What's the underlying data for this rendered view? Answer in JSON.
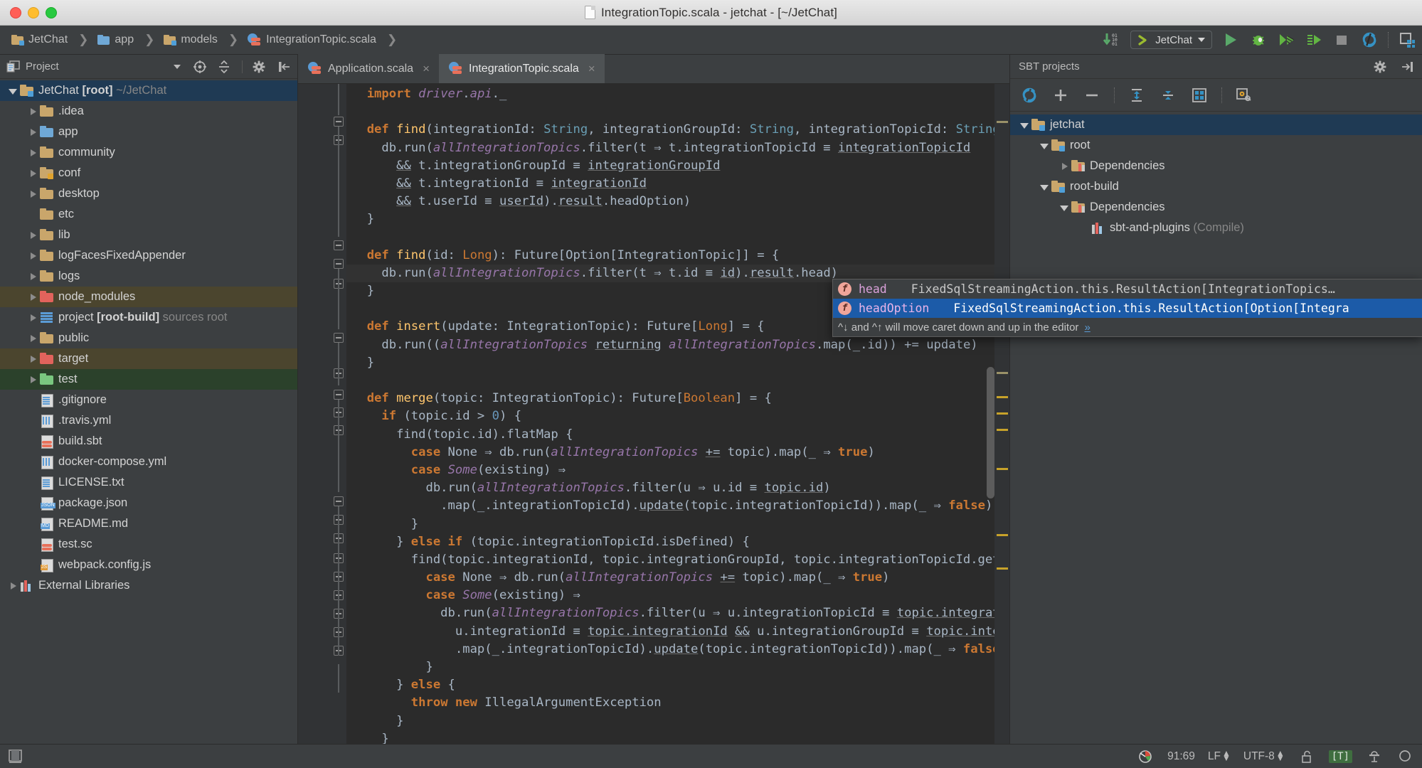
{
  "window": {
    "title": "IntegrationTopic.scala - jetchat - [~/JetChat]",
    "doc_icon": "document-icon",
    "traffic_lights": [
      "close",
      "minimize",
      "maximize"
    ]
  },
  "navbar": {
    "breadcrumb": [
      {
        "label": "JetChat",
        "icon": "module-folder-icon"
      },
      {
        "label": "app",
        "icon": "source-folder-icon"
      },
      {
        "label": "models",
        "icon": "package-folder-icon"
      },
      {
        "label": "IntegrationTopic.scala",
        "icon": "scala-file-icon"
      }
    ],
    "toolbar": {
      "update_label": "01 10 01",
      "run_config": "JetChat",
      "buttons": [
        "run",
        "debug",
        "coverage",
        "profile",
        "stop",
        "sync",
        "project-structure"
      ]
    }
  },
  "project_panel": {
    "title": "Project",
    "toolbar_icons": [
      "locate-icon",
      "collapse-all-icon",
      "settings-icon",
      "hide-icon"
    ],
    "tree": [
      {
        "label": "JetChat",
        "bold": "[root]",
        "dim": "~/JetChat",
        "depth": 0,
        "arrow": "open",
        "icon": "module-folder",
        "state": "selected"
      },
      {
        "label": ".idea",
        "depth": 1,
        "arrow": "closed",
        "icon": "folder"
      },
      {
        "label": "app",
        "depth": 1,
        "arrow": "closed",
        "icon": "folder-blue"
      },
      {
        "label": "community",
        "depth": 1,
        "arrow": "closed",
        "icon": "folder"
      },
      {
        "label": "conf",
        "depth": 1,
        "arrow": "closed",
        "icon": "folder-resource"
      },
      {
        "label": "desktop",
        "depth": 1,
        "arrow": "closed",
        "icon": "folder"
      },
      {
        "label": "etc",
        "depth": 1,
        "arrow": "none",
        "icon": "folder"
      },
      {
        "label": "lib",
        "depth": 1,
        "arrow": "closed",
        "icon": "folder"
      },
      {
        "label": "logFacesFixedAppender",
        "depth": 1,
        "arrow": "closed",
        "icon": "folder"
      },
      {
        "label": "logs",
        "depth": 1,
        "arrow": "closed",
        "icon": "folder"
      },
      {
        "label": "node_modules",
        "depth": 1,
        "arrow": "closed",
        "icon": "folder-red",
        "state": "excluded"
      },
      {
        "label": "project",
        "bold": "[root-build]",
        "dim": "sources root",
        "depth": 1,
        "arrow": "closed",
        "icon": "sources-stack"
      },
      {
        "label": "public",
        "depth": 1,
        "arrow": "closed",
        "icon": "folder"
      },
      {
        "label": "target",
        "depth": 1,
        "arrow": "closed",
        "icon": "folder-red",
        "state": "excluded"
      },
      {
        "label": "test",
        "depth": 1,
        "arrow": "closed",
        "icon": "folder-green",
        "state": "test-source"
      },
      {
        "label": ".gitignore",
        "depth": 1,
        "arrow": "none",
        "icon": "text-file"
      },
      {
        "label": ".travis.yml",
        "depth": 1,
        "arrow": "none",
        "icon": "yaml-file"
      },
      {
        "label": "build.sbt",
        "depth": 1,
        "arrow": "none",
        "icon": "sbt-file"
      },
      {
        "label": "docker-compose.yml",
        "depth": 1,
        "arrow": "none",
        "icon": "yaml-file"
      },
      {
        "label": "LICENSE.txt",
        "depth": 1,
        "arrow": "none",
        "icon": "text-file"
      },
      {
        "label": "package.json",
        "depth": 1,
        "arrow": "none",
        "icon": "json-file"
      },
      {
        "label": "README.md",
        "depth": 1,
        "arrow": "none",
        "icon": "md-file"
      },
      {
        "label": "test.sc",
        "depth": 1,
        "arrow": "none",
        "icon": "sbt-file"
      },
      {
        "label": "webpack.config.js",
        "depth": 1,
        "arrow": "none",
        "icon": "js-file"
      },
      {
        "label": "External Libraries",
        "depth": 0,
        "arrow": "closed",
        "icon": "library"
      }
    ]
  },
  "editor": {
    "tabs": [
      {
        "label": "Application.scala",
        "active": false,
        "icon": "scala-file-icon",
        "close": "×"
      },
      {
        "label": "IntegrationTopic.scala",
        "active": true,
        "icon": "scala-file-icon",
        "close": "×"
      }
    ],
    "code_lines": [
      {
        "caret": false,
        "html": "  <span class='kw'>import</span> <span class='it'>driver</span>.<span class='it'>api</span>._"
      },
      {
        "caret": false,
        "html": ""
      },
      {
        "caret": false,
        "html": "  <span class='kw'>def</span> <span class='fn'>find</span>(integrationId: <span class='ty'>String</span>, integrationGroupId: <span class='ty'>String</span>, integrationTopicId: <span class='ty'>String</span>, u"
      },
      {
        "caret": false,
        "html": "    db.run(<span class='it'>allIntegrationTopics</span>.filter(t ⇒ t.integrationTopicId <span class='eqq'>≡</span> <span class='ul'>integrationTopicId</span>"
      },
      {
        "caret": false,
        "html": "      <span class='ul'>&amp;&amp;</span> t.integrationGroupId <span class='eqq'>≡</span> <span class='ul'>integrationGroupId</span>"
      },
      {
        "caret": false,
        "html": "      <span class='ul'>&amp;&amp;</span> t.integrationId <span class='eqq'>≡</span> <span class='ul'>integrationId</span>"
      },
      {
        "caret": false,
        "html": "      <span class='ul'>&amp;&amp;</span> t.userId <span class='eqq'>≡</span> <span class='ul'>userId</span>).<span class='ul'>result</span>.headOption)"
      },
      {
        "caret": false,
        "html": "  }"
      },
      {
        "caret": false,
        "html": ""
      },
      {
        "caret": false,
        "html": "  <span class='kw'>def</span> <span class='fn'>find</span>(id: <span class='tyo'>Long</span>): Future[Option[IntegrationTopic]] = {"
      },
      {
        "caret": true,
        "html": "    db.run(<span class='it'>allIntegrationTopics</span>.filter(t ⇒ t.id <span class='eqq'>≡</span> <span class='ul'>id</span>).<span class='ul'>result</span>.head)"
      },
      {
        "caret": false,
        "html": "  }"
      },
      {
        "caret": false,
        "html": ""
      },
      {
        "caret": false,
        "html": "  <span class='kw'>def</span> <span class='fn'>insert</span>(update: IntegrationTopic): Future[<span class='tyo'>Long</span>] = {"
      },
      {
        "caret": false,
        "html": "    db.run((<span class='it'>allIntegrationTopics</span> <span class='ul'>returning</span> <span class='it'>allIntegrationTopics</span>.map(_.id)) += update)"
      },
      {
        "caret": false,
        "html": "  }"
      },
      {
        "caret": false,
        "html": ""
      },
      {
        "caret": false,
        "html": "  <span class='kw'>def</span> <span class='fn'>merge</span>(topic: IntegrationTopic): Future[<span class='tyo'>Boolean</span>] = {"
      },
      {
        "caret": false,
        "html": "    <span class='kw'>if</span> (topic.id &gt; <span class='num'>0</span>) {"
      },
      {
        "caret": false,
        "html": "      find(topic.id).flatMap {"
      },
      {
        "caret": false,
        "html": "        <span class='kw'>case</span> None ⇒ db.run(<span class='it'>allIntegrationTopics</span> <span class='ul'>+=</span> topic).map(_ ⇒ <span class='kw'>true</span>)"
      },
      {
        "caret": false,
        "html": "        <span class='kw'>case</span> <span class='it'>Some</span>(existing) ⇒"
      },
      {
        "caret": false,
        "html": "          db.run(<span class='it'>allIntegrationTopics</span>.filter(u ⇒ u.id <span class='eqq'>≡</span> <span class='ul'>topic.id</span>)"
      },
      {
        "caret": false,
        "html": "            .map(_.integrationTopicId).<span class='ul'>update</span>(topic.integrationTopicId)).map(_ ⇒ <span class='kw'>false</span>)"
      },
      {
        "caret": false,
        "html": "        }"
      },
      {
        "caret": false,
        "html": "      } <span class='kw'>else if</span> (topic.integrationTopicId.isDefined) {"
      },
      {
        "caret": false,
        "html": "        find(topic.integrationId, topic.integrationGroupId, topic.integrationTopicId.get, top"
      },
      {
        "caret": false,
        "html": "          <span class='kw'>case</span> None ⇒ db.run(<span class='it'>allIntegrationTopics</span> <span class='ul'>+=</span> topic).map(_ ⇒ <span class='kw'>true</span>)"
      },
      {
        "caret": false,
        "html": "          <span class='kw'>case</span> <span class='it'>Some</span>(existing) ⇒"
      },
      {
        "caret": false,
        "html": "            db.run(<span class='it'>allIntegrationTopics</span>.filter(u ⇒ u.integrationTopicId <span class='eqq'>≡</span> <span class='ul'>topic.integratio</span>"
      },
      {
        "caret": false,
        "html": "              u.integrationId <span class='eqq'>≡</span> <span class='ul'>topic.integrationId</span> <span class='ul'>&amp;&amp;</span> u.integrationGroupId <span class='eqq'>≡</span> <span class='ul'>topic.integ</span>"
      },
      {
        "caret": false,
        "html": "              .map(_.integrationTopicId).<span class='ul'>update</span>(topic.integrationTopicId)).map(_ ⇒ <span class='kw'>false</span>)"
      },
      {
        "caret": false,
        "html": "          }"
      },
      {
        "caret": false,
        "html": "      } <span class='kw'>else</span> {"
      },
      {
        "caret": false,
        "html": "        <span class='kw'>throw new</span> IllegalArgumentException"
      },
      {
        "caret": false,
        "html": "      }"
      },
      {
        "caret": false,
        "html": "    }"
      }
    ],
    "autocomplete": {
      "items": [
        {
          "kind": "f",
          "name": "head",
          "signature": "FixedSqlStreamingAction.this.ResultAction[IntegrationTopics…",
          "selected": false
        },
        {
          "kind": "f",
          "name": "headOption",
          "signature": "FixedSqlStreamingAction.this.ResultAction[Option[Integra",
          "selected": true
        }
      ],
      "hint": "^↓ and ^↑ will move caret down and up in the editor",
      "hint_more": "»"
    }
  },
  "sbt_panel": {
    "title": "SBT projects",
    "header_icons": [
      "settings-icon",
      "hide-icon"
    ],
    "toolbar_icons": [
      "refresh-icon",
      "add-icon",
      "remove-icon",
      "expand-all-icon",
      "collapse-all-icon",
      "modules-icon",
      "settings-build-icon"
    ],
    "tree": [
      {
        "label": "jetchat",
        "depth": 0,
        "arrow": "open",
        "icon": "module-folder",
        "state": "selected"
      },
      {
        "label": "root",
        "depth": 1,
        "arrow": "open",
        "icon": "module-folder"
      },
      {
        "label": "Dependencies",
        "depth": 2,
        "arrow": "closed",
        "icon": "deps-folder"
      },
      {
        "label": "root-build",
        "depth": 1,
        "arrow": "open",
        "icon": "module-folder"
      },
      {
        "label": "Dependencies",
        "depth": 2,
        "arrow": "open",
        "icon": "deps-folder"
      },
      {
        "label": "sbt-and-plugins",
        "dim": "(Compile)",
        "depth": 3,
        "arrow": "none",
        "icon": "library"
      }
    ]
  },
  "status_bar": {
    "left_icon": "toggle-tool-window-icon",
    "caret_position": "91:69",
    "line_separator": "LF",
    "encoding": "UTF-8",
    "lock_icon": "unlocked-icon",
    "tab_badge": "[T]",
    "inspector_icon": "inspector-hat-icon",
    "search_icon": "search-icon",
    "memory_icon": "memory-indicator"
  },
  "colors": {
    "chrome": "#3c3f41",
    "editor_bg": "#2b2b2b",
    "gutter": "#313335",
    "selection_blue": "#1f3a54",
    "ac_selected": "#1c5ba8",
    "keyword": "#cc7832",
    "method": "#ffc66d",
    "field_italic": "#9876aa",
    "type": "#6a9fb5",
    "number": "#6897bb",
    "text": "#a9b7c6",
    "warn_stripe": "#c7a22a",
    "run_green": "#59a869"
  }
}
